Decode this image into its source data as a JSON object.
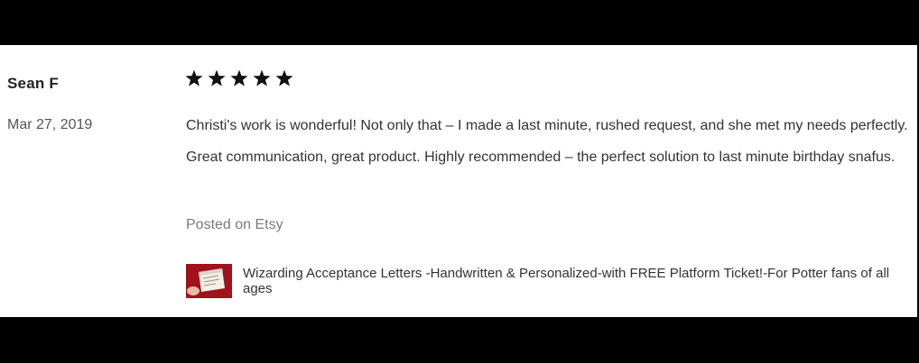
{
  "review": {
    "reviewer_name": "Sean F",
    "date": "Mar 27, 2019",
    "rating": 5,
    "rating_max": 5,
    "text": "Christi's work is wonderful! Not only that – I made a last minute, rushed request, and she met my needs perfectly. Great communication, great product. Highly recommended – the perfect solution to last minute birthday snafus.",
    "source": "Posted on Etsy",
    "product": {
      "title": "Wizarding Acceptance Letters -Handwritten & Personalized-with FREE Platform Ticket!-For Potter fans of all ages",
      "thumbnail_icon": "product-thumbnail"
    }
  },
  "colors": {
    "frame": "#000000",
    "card": "#ffffff",
    "star": "#111111",
    "name": "#222222",
    "muted": "#7a7a7a",
    "thumb_red": "#b3141f"
  }
}
